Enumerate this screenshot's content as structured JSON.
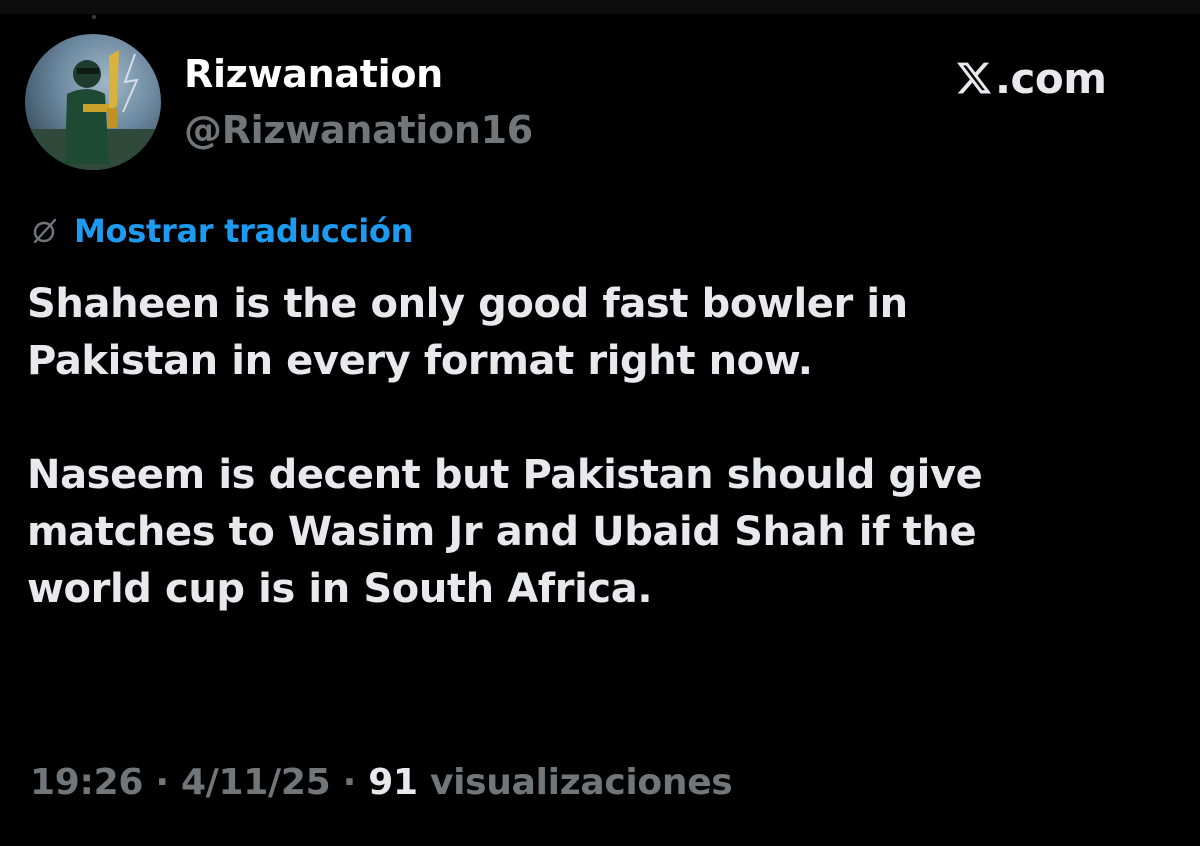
{
  "author": {
    "display_name": "Rizwanation",
    "handle": "@Rizwanation16",
    "avatar_icon": "cricketer-avatar"
  },
  "brand": {
    "icon": "x-logo-icon",
    "text": ".com"
  },
  "translate": {
    "icon": "translate-globe-icon",
    "label": "Mostrar traducción",
    "color": "#1d9bf0"
  },
  "tweet": {
    "paragraph_1": "Shaheen is the only good fast bowler in\nPakistan in every format right now.",
    "paragraph_2": "Naseem is decent but Pakistan should give\nmatches to Wasim Jr and Ubaid Shah if the\nworld cup is in South Africa."
  },
  "meta": {
    "time": "19:26",
    "separator": " · ",
    "date": "4/11/25",
    "views_count": "91",
    "views_label": "visualizaciones"
  },
  "colors": {
    "background": "#000000",
    "primary_text": "#e7e9ea",
    "secondary_text": "#71767b",
    "link": "#1d9bf0"
  }
}
